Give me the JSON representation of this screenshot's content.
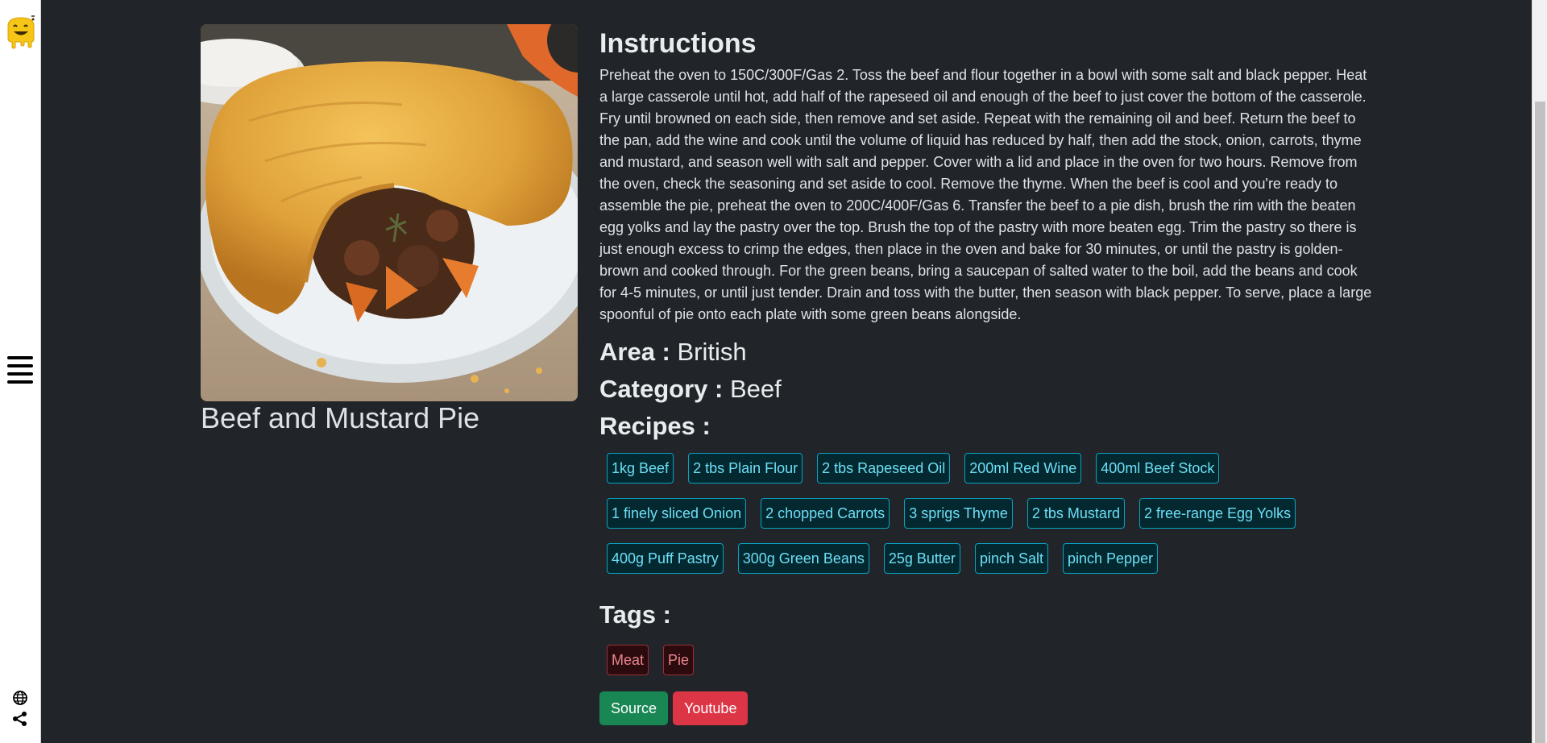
{
  "recipe": {
    "name": "Beef and Mustard Pie",
    "instructions_heading": "Instructions",
    "instructions": "Preheat the oven to 150C/300F/Gas 2. Toss the beef and flour together in a bowl with some salt and black pepper. Heat a large casserole until hot, add half of the rapeseed oil and enough of the beef to just cover the bottom of the casserole. Fry until browned on each side, then remove and set aside. Repeat with the remaining oil and beef. Return the beef to the pan, add the wine and cook until the volume of liquid has reduced by half, then add the stock, onion, carrots, thyme and mustard, and season well with salt and pepper. Cover with a lid and place in the oven for two hours. Remove from the oven, check the seasoning and set aside to cool. Remove the thyme. When the beef is cool and you're ready to assemble the pie, preheat the oven to 200C/400F/Gas 6. Transfer the beef to a pie dish, brush the rim with the beaten egg yolks and lay the pastry over the top. Brush the top of the pastry with more beaten egg. Trim the pastry so there is just enough excess to crimp the edges, then place in the oven and bake for 30 minutes, or until the pastry is golden-brown and cooked through. For the green beans, bring a saucepan of salted water to the boil, add the beans and cook for 4-5 minutes, or until just tender. Drain and toss with the butter, then season with black pepper. To serve, place a large spoonful of pie onto each plate with some green beans alongside.",
    "area_label": "Area :",
    "area": "British",
    "category_label": "Category :",
    "category": "Beef",
    "recipes_label": "Recipes :",
    "ingredients": [
      "1kg Beef",
      "2 tbs Plain Flour",
      "2 tbs Rapeseed Oil",
      "200ml Red Wine",
      "400ml Beef Stock",
      "1 finely sliced Onion",
      "2 chopped Carrots",
      "3 sprigs Thyme",
      "2 tbs Mustard",
      "2 free-range Egg Yolks",
      "400g Puff Pastry",
      "300g Green Beans",
      "25g Butter",
      "pinch Salt",
      "pinch Pepper"
    ],
    "tags_label": "Tags :",
    "tags": [
      "Meat",
      "Pie"
    ],
    "source_label": "Source",
    "youtube_label": "Youtube"
  },
  "sidebar": {
    "logo_icon": "smiley-logo-icon",
    "menu_icon": "hamburger-menu-icon",
    "globe_icon": "globe-icon",
    "share_icon": "share-icon"
  },
  "colors": {
    "background": "#212529",
    "chip_border": "#0aa2c0",
    "chip_text": "#6edff6",
    "tag_border": "#9a2f39",
    "tag_text": "#ea868f",
    "source_button": "#198754",
    "youtube_button": "#dc3545"
  }
}
